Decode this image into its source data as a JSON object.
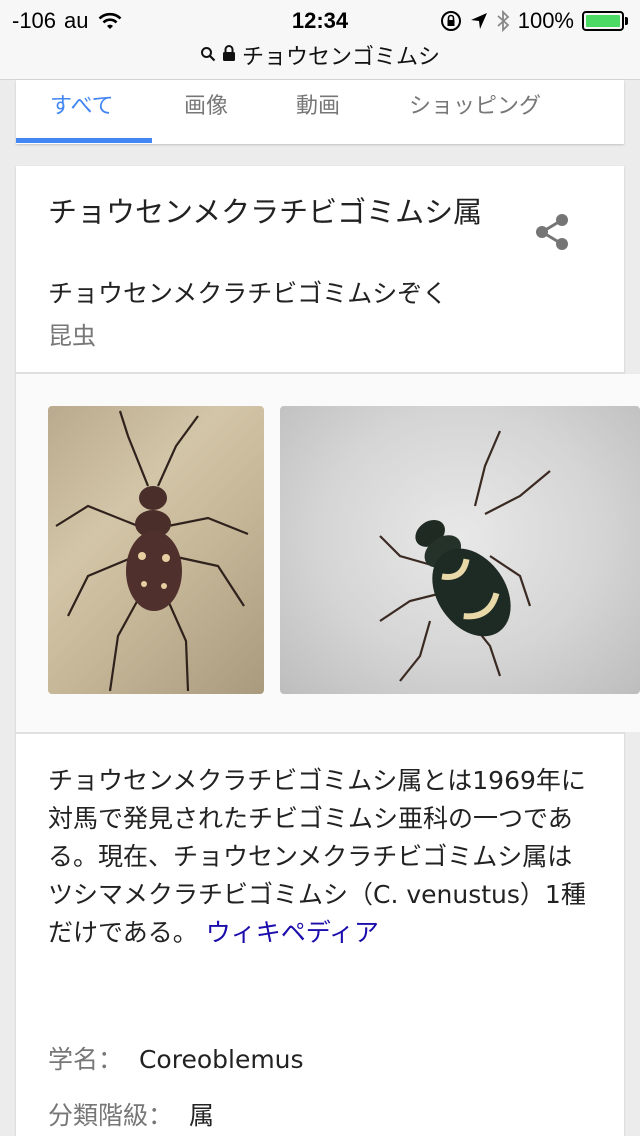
{
  "status_bar": {
    "signal": "-106",
    "carrier": "au",
    "time": "12:34",
    "battery": "100%",
    "battery_color": "#4cd964"
  },
  "url_bar": {
    "query": "チョウセンゴミムシ",
    "search_icon": "search-icon",
    "lock_icon": "lock-icon"
  },
  "tabs": [
    {
      "label": "すべて",
      "active": true
    },
    {
      "label": "画像",
      "active": false
    },
    {
      "label": "動画",
      "active": false
    },
    {
      "label": "ショッピング",
      "active": false
    }
  ],
  "accent_color": "#4285f4",
  "knowledge_panel": {
    "title": "チョウセンメクラチビゴミムシ属",
    "reading": "チョウセンメクラチビゴミムシぞく",
    "category": "昆虫",
    "share_icon": "share-icon",
    "images": [
      {
        "alt": "beetle-photo-1"
      },
      {
        "alt": "beetle-photo-2"
      }
    ],
    "description": "チョウセンメクラチビゴミムシ属とは1969年に対馬で発見されたチビゴミムシ亜科の一つである。現在、チョウセンメクラチビゴミムシ属はツシマメクラチビゴミムシ（C. venustus）1種だけである。",
    "source_link": "ウィキペディア",
    "link_color": "#1a0dab",
    "facts": [
      {
        "label": "学名：",
        "value": "Coreoblemus"
      },
      {
        "label": "分類階級：",
        "value": "属"
      }
    ]
  }
}
